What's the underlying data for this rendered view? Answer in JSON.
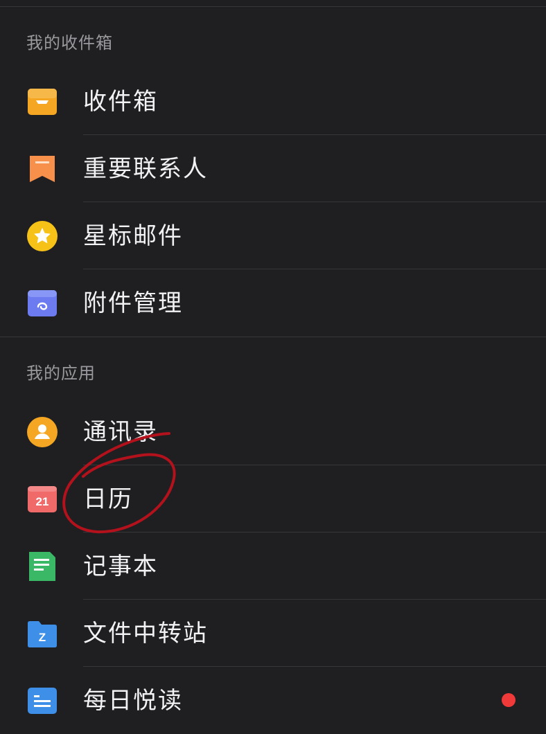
{
  "sections": {
    "mailbox": {
      "title": "我的收件箱",
      "items": [
        {
          "label": "收件箱",
          "icon": "inbox-tray-icon",
          "color": "#f5a623"
        },
        {
          "label": "重要联系人",
          "icon": "bookmark-icon",
          "color": "#f7904a"
        },
        {
          "label": "星标邮件",
          "icon": "star-icon",
          "color": "#f7c218"
        },
        {
          "label": "附件管理",
          "icon": "attachment-icon",
          "color": "#6c7cf0"
        }
      ]
    },
    "apps": {
      "title": "我的应用",
      "items": [
        {
          "label": "通讯录",
          "icon": "contact-icon",
          "color": "#f5a623"
        },
        {
          "label": "日历",
          "icon": "calendar-icon",
          "color": "#f06a6a",
          "icon_text": "21"
        },
        {
          "label": "记事本",
          "icon": "notepad-icon",
          "color": "#3bb866"
        },
        {
          "label": "文件中转站",
          "icon": "folder-icon",
          "color": "#3d8fe8",
          "icon_text": "Z"
        },
        {
          "label": "每日悦读",
          "icon": "reading-icon",
          "color": "#3d8fe8",
          "badge_color": "#f03a3a"
        }
      ]
    }
  },
  "annotation": {
    "type": "hand-drawn-circle",
    "color": "#b3121c",
    "target": "日历"
  }
}
